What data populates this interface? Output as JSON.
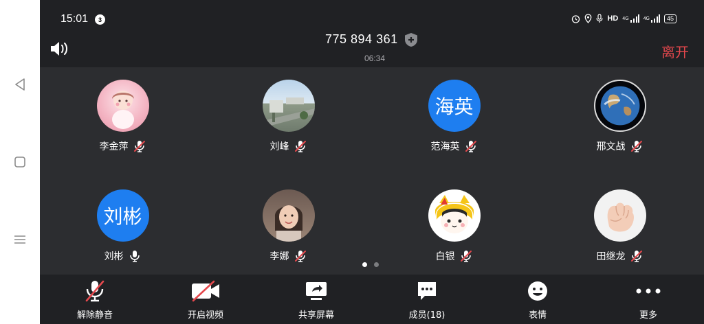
{
  "status_bar": {
    "time": "15:01",
    "notification_count": "3",
    "network_label": "HD",
    "signal_1": "4G",
    "signal_2": "4G",
    "battery": "45"
  },
  "header": {
    "meeting_id": "775 894 361",
    "duration": "06:34",
    "leave_label": "离开",
    "icons": [
      "speaker-icon",
      "shield-icon"
    ]
  },
  "participants": [
    {
      "name": "李金萍",
      "avatar_type": "photo",
      "avatar_theme": "pink-cartoon",
      "mic": "muted"
    },
    {
      "name": "刘峰",
      "avatar_type": "photo",
      "avatar_theme": "city-road",
      "mic": "muted"
    },
    {
      "name": "范海英",
      "avatar_type": "text",
      "avatar_text": "海英",
      "mic": "muted"
    },
    {
      "name": "邢文战",
      "avatar_type": "photo",
      "avatar_theme": "earth",
      "mic": "muted"
    },
    {
      "name": "刘彬",
      "avatar_type": "text",
      "avatar_text": "刘彬",
      "mic": "on"
    },
    {
      "name": "李娜",
      "avatar_type": "photo",
      "avatar_theme": "woman-portrait",
      "mic": "muted"
    },
    {
      "name": "白银",
      "avatar_type": "photo",
      "avatar_theme": "cartoon-girl",
      "mic": "muted"
    },
    {
      "name": "田继龙",
      "avatar_type": "photo",
      "avatar_theme": "baby-fist",
      "mic": "muted"
    }
  ],
  "pager": {
    "pages": 2,
    "active_page": 1
  },
  "toolbar": {
    "unmute_label": "解除静音",
    "video_label": "开启视频",
    "share_label": "共享屏幕",
    "members_label": "成员(18)",
    "reactions_label": "表情",
    "more_label": "更多"
  },
  "colors": {
    "accent_blue": "#1e7ef0",
    "leave_red": "#e5484d",
    "muted_red": "#e5484d",
    "background": "#2c2d30",
    "bar_background": "#202124"
  }
}
